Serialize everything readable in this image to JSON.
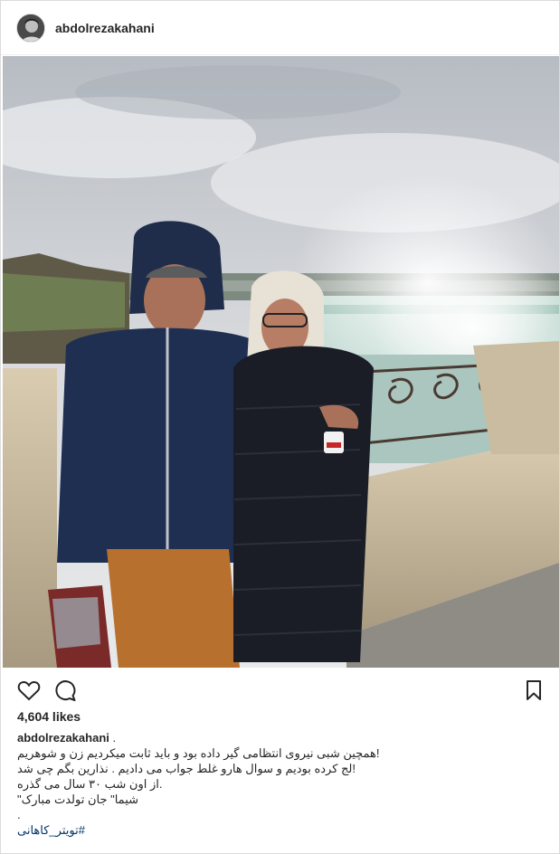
{
  "post": {
    "username": "abdolrezakahani",
    "likes": "4,604 likes",
    "caption": {
      "username": "abdolrezakahani",
      "username_suffix": " .",
      "lines": [
        "!همچین شبی نیروی انتظامی گیر داده بود و باید ثابت میکردیم زن و شوهریم",
        "!لج کرده بودیم و سوال هارو غلط جواب می دادیم . نذارین بگم چی شد",
        ".از اون شب ۳۰ سال می گذره",
        "شیما\" جان تولدت مبارک\"",
        "."
      ],
      "hashtag": "#تویتر_کاهانی"
    }
  },
  "icons": {
    "avatar": "profile-avatar",
    "like": "heart-icon",
    "comment": "comment-bubble-icon",
    "save": "bookmark-icon"
  },
  "colors": {
    "text": "#262626",
    "hashtag": "#003569",
    "border": "#dbdbdb"
  }
}
